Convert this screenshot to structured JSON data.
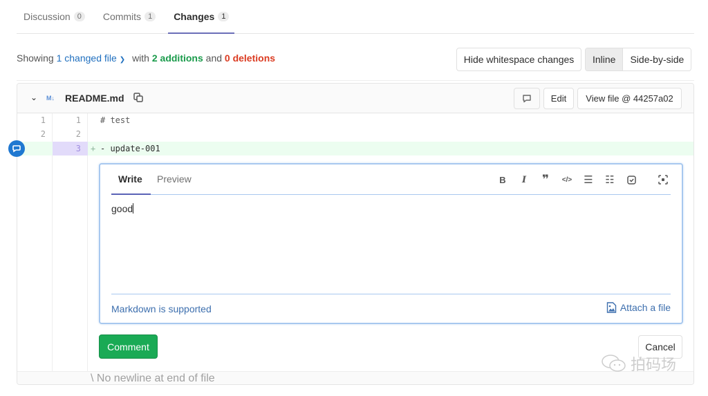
{
  "tabs": [
    {
      "label": "Discussion",
      "count": "0",
      "active": false
    },
    {
      "label": "Commits",
      "count": "1",
      "active": false
    },
    {
      "label": "Changes",
      "count": "1",
      "active": true
    }
  ],
  "summary": {
    "showing": "Showing",
    "changed_files": "1 changed file",
    "with": "with",
    "additions": "2 additions",
    "and": "and",
    "deletions": "0 deletions"
  },
  "toolbar": {
    "hide_whitespace": "Hide whitespace changes",
    "inline": "Inline",
    "side_by_side": "Side-by-side",
    "selected_view": "Inline"
  },
  "file": {
    "type_badge": "M↓",
    "name": "README.md",
    "edit_label": "Edit",
    "view_file_label": "View file @ 44257a02",
    "lines": [
      {
        "old": "1",
        "new": "1",
        "prefix": " ",
        "text": "# test",
        "type": "unchanged"
      },
      {
        "old": "2",
        "new": "2",
        "prefix": " ",
        "text": "",
        "type": "unchanged"
      },
      {
        "old": "",
        "new": "3",
        "prefix": "+",
        "text": "- update-001",
        "type": "added"
      }
    ],
    "no_newline": "\\ No newline at end of file"
  },
  "editor": {
    "write_tab": "Write",
    "preview_tab": "Preview",
    "content": "good",
    "markdown_hint": "Markdown is supported",
    "attach_label": "Attach a file",
    "toolbar_icons": [
      "bold-icon",
      "italic-icon",
      "quote-icon",
      "code-icon",
      "bullet-list-icon",
      "numbered-list-icon",
      "task-list-icon",
      "fullscreen-icon"
    ]
  },
  "actions": {
    "comment": "Comment",
    "cancel": "Cancel"
  },
  "watermark": "拍码场",
  "colors": {
    "accent": "#1f78d1",
    "success": "#1aaa55",
    "danger": "#db3b21",
    "tab_underline": "#6b6eb8"
  }
}
